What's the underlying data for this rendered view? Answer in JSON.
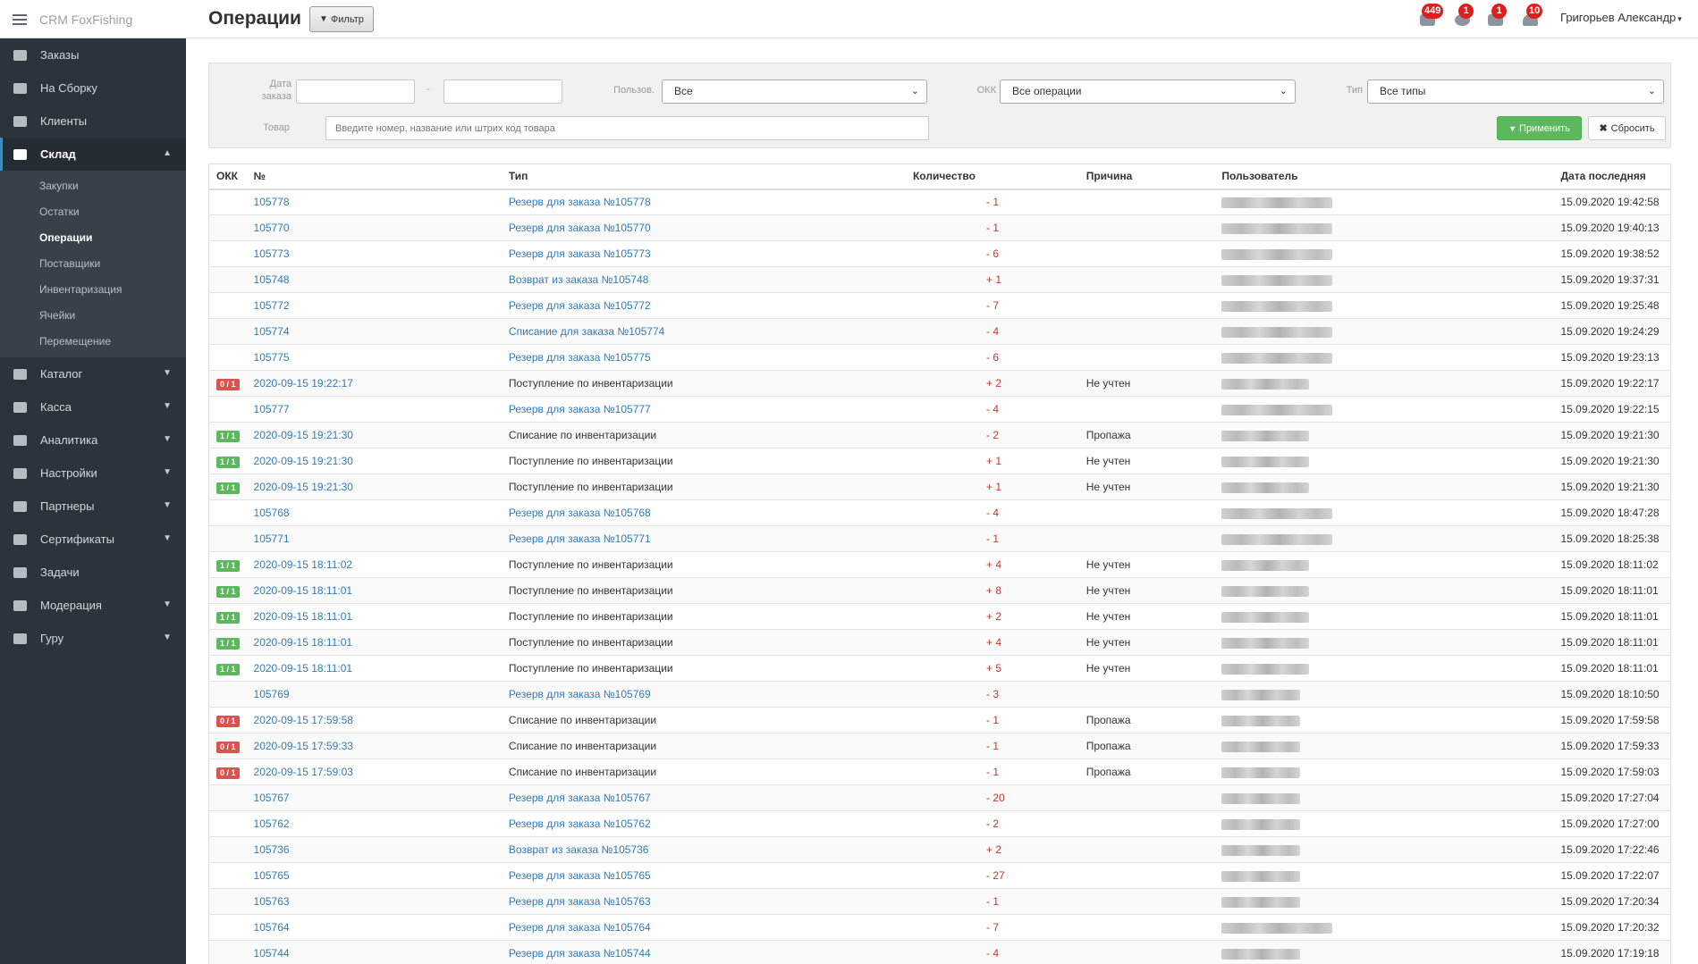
{
  "app": {
    "name": "CRM FoxFishing"
  },
  "header": {
    "title": "Операции",
    "filter_button": "Фильтр",
    "user": "Григорьев Александр",
    "notifications": [
      {
        "icon": "comments-icon",
        "count": "449"
      },
      {
        "icon": "phone-icon",
        "count": "1"
      },
      {
        "icon": "calendar-icon",
        "count": "1"
      },
      {
        "icon": "bell-icon",
        "count": "10"
      }
    ]
  },
  "sidebar": {
    "items": [
      {
        "label": "Заказы",
        "icon": "cart-icon"
      },
      {
        "label": "На Сборку",
        "icon": "box-icon"
      },
      {
        "label": "Клиенты",
        "icon": "users-icon"
      },
      {
        "label": "Склад",
        "icon": "home-icon",
        "expanded": true
      },
      {
        "label": "Каталог",
        "icon": "list-icon"
      },
      {
        "label": "Касса",
        "icon": "money-icon"
      },
      {
        "label": "Аналитика",
        "icon": "chart-icon"
      },
      {
        "label": "Настройки",
        "icon": "cogs-icon"
      },
      {
        "label": "Партнеры",
        "icon": "handshake-icon"
      },
      {
        "label": "Сертификаты",
        "icon": "certificate-icon"
      },
      {
        "label": "Задачи",
        "icon": "tag-icon"
      },
      {
        "label": "Модерация",
        "icon": "cogs-icon"
      },
      {
        "label": "Гуру",
        "icon": "walking-icon"
      }
    ],
    "warehouse_subitems": [
      "Закупки",
      "Остатки",
      "Операции",
      "Поставщики",
      "Инвентаризация",
      "Ячейки",
      "Перемещение"
    ],
    "current_subitem": "Операции"
  },
  "filters": {
    "order_date_label": "Дата заказа",
    "date_separator": "-",
    "user_label": "Пользов.",
    "user_value": "Все",
    "okk_label": "ОКК",
    "okk_value": "Все операции",
    "type_label": "Тип",
    "type_value": "Все типы",
    "product_label": "Товар",
    "product_placeholder": "Введите номер, название или штрих код товара",
    "apply": "Применить",
    "reset": "Сбросить"
  },
  "table": {
    "columns": [
      "ОКК",
      "№",
      "Тип",
      "Количество",
      "Причина",
      "Пользователь",
      "Дата последняя"
    ],
    "rows": [
      {
        "okk": "",
        "num": "105778",
        "type": "Резерв для заказа №105778",
        "link": true,
        "qty": "- 1",
        "reason": "",
        "user_blur": 124,
        "date": "15.09.2020 19:42:58"
      },
      {
        "okk": "",
        "num": "105770",
        "type": "Резерв для заказа №105770",
        "link": true,
        "qty": "- 1",
        "reason": "",
        "user_blur": 124,
        "date": "15.09.2020 19:40:13"
      },
      {
        "okk": "",
        "num": "105773",
        "type": "Резерв для заказа №105773",
        "link": true,
        "qty": "- 6",
        "reason": "",
        "user_blur": 124,
        "date": "15.09.2020 19:38:52"
      },
      {
        "okk": "",
        "num": "105748",
        "type": "Возврат из заказа №105748",
        "link": true,
        "qty": "+ 1",
        "reason": "",
        "user_blur": 124,
        "date": "15.09.2020 19:37:31"
      },
      {
        "okk": "",
        "num": "105772",
        "type": "Резерв для заказа №105772",
        "link": true,
        "qty": "- 7",
        "reason": "",
        "user_blur": 124,
        "date": "15.09.2020 19:25:48"
      },
      {
        "okk": "",
        "num": "105774",
        "type": "Списание для заказа №105774",
        "link": true,
        "qty": "- 4",
        "reason": "",
        "user_blur": 124,
        "date": "15.09.2020 19:24:29"
      },
      {
        "okk": "",
        "num": "105775",
        "type": "Резерв для заказа №105775",
        "link": true,
        "qty": "- 6",
        "reason": "",
        "user_blur": 124,
        "date": "15.09.2020 19:23:13"
      },
      {
        "okk": "0 / 1",
        "okk_color": "red",
        "num": "2020-09-15 19:22:17",
        "type": "Поступление по инвентаризации",
        "link": false,
        "qty": "+ 2",
        "reason": "Не учтен",
        "user_blur": 98,
        "date": "15.09.2020 19:22:17"
      },
      {
        "okk": "",
        "num": "105777",
        "type": "Резерв для заказа №105777",
        "link": true,
        "qty": "- 4",
        "reason": "",
        "user_blur": 124,
        "date": "15.09.2020 19:22:15"
      },
      {
        "okk": "1 / 1",
        "okk_color": "green",
        "num": "2020-09-15 19:21:30",
        "type": "Списание по инвентаризации",
        "link": false,
        "qty": "- 2",
        "reason": "Пропажа",
        "user_blur": 98,
        "date": "15.09.2020 19:21:30"
      },
      {
        "okk": "1 / 1",
        "okk_color": "green",
        "num": "2020-09-15 19:21:30",
        "type": "Поступление по инвентаризации",
        "link": false,
        "qty": "+ 1",
        "reason": "Не учтен",
        "user_blur": 98,
        "date": "15.09.2020 19:21:30"
      },
      {
        "okk": "1 / 1",
        "okk_color": "green",
        "num": "2020-09-15 19:21:30",
        "type": "Поступление по инвентаризации",
        "link": false,
        "qty": "+ 1",
        "reason": "Не учтен",
        "user_blur": 98,
        "date": "15.09.2020 19:21:30"
      },
      {
        "okk": "",
        "num": "105768",
        "type": "Резерв для заказа №105768",
        "link": true,
        "qty": "- 4",
        "reason": "",
        "user_blur": 124,
        "date": "15.09.2020 18:47:28"
      },
      {
        "okk": "",
        "num": "105771",
        "type": "Резерв для заказа №105771",
        "link": true,
        "qty": "- 1",
        "reason": "",
        "user_blur": 124,
        "date": "15.09.2020 18:25:38"
      },
      {
        "okk": "1 / 1",
        "okk_color": "green",
        "num": "2020-09-15 18:11:02",
        "type": "Поступление по инвентаризации",
        "link": false,
        "qty": "+ 4",
        "reason": "Не учтен",
        "user_blur": 98,
        "date": "15.09.2020 18:11:02"
      },
      {
        "okk": "1 / 1",
        "okk_color": "green",
        "num": "2020-09-15 18:11:01",
        "type": "Поступление по инвентаризации",
        "link": false,
        "qty": "+ 8",
        "reason": "Не учтен",
        "user_blur": 98,
        "date": "15.09.2020 18:11:01"
      },
      {
        "okk": "1 / 1",
        "okk_color": "green",
        "num": "2020-09-15 18:11:01",
        "type": "Поступление по инвентаризации",
        "link": false,
        "qty": "+ 2",
        "reason": "Не учтен",
        "user_blur": 98,
        "date": "15.09.2020 18:11:01"
      },
      {
        "okk": "1 / 1",
        "okk_color": "green",
        "num": "2020-09-15 18:11:01",
        "type": "Поступление по инвентаризации",
        "link": false,
        "qty": "+ 4",
        "reason": "Не учтен",
        "user_blur": 98,
        "date": "15.09.2020 18:11:01"
      },
      {
        "okk": "1 / 1",
        "okk_color": "green",
        "num": "2020-09-15 18:11:01",
        "type": "Поступление по инвентаризации",
        "link": false,
        "qty": "+ 5",
        "reason": "Не учтен",
        "user_blur": 98,
        "date": "15.09.2020 18:11:01"
      },
      {
        "okk": "",
        "num": "105769",
        "type": "Резерв для заказа №105769",
        "link": true,
        "qty": "- 3",
        "reason": "",
        "user_blur": 88,
        "date": "15.09.2020 18:10:50"
      },
      {
        "okk": "0 / 1",
        "okk_color": "red",
        "num": "2020-09-15 17:59:58",
        "type": "Списание по инвентаризации",
        "link": false,
        "qty": "- 1",
        "reason": "Пропажа",
        "user_blur": 88,
        "date": "15.09.2020 17:59:58"
      },
      {
        "okk": "0 / 1",
        "okk_color": "red",
        "num": "2020-09-15 17:59:33",
        "type": "Списание по инвентаризации",
        "link": false,
        "qty": "- 1",
        "reason": "Пропажа",
        "user_blur": 88,
        "date": "15.09.2020 17:59:33"
      },
      {
        "okk": "0 / 1",
        "okk_color": "red",
        "num": "2020-09-15 17:59:03",
        "type": "Списание по инвентаризации",
        "link": false,
        "qty": "- 1",
        "reason": "Пропажа",
        "user_blur": 88,
        "date": "15.09.2020 17:59:03"
      },
      {
        "okk": "",
        "num": "105767",
        "type": "Резерв для заказа №105767",
        "link": true,
        "qty": "- 20",
        "reason": "",
        "user_blur": 88,
        "date": "15.09.2020 17:27:04"
      },
      {
        "okk": "",
        "num": "105762",
        "type": "Резерв для заказа №105762",
        "link": true,
        "qty": "- 2",
        "reason": "",
        "user_blur": 88,
        "date": "15.09.2020 17:27:00"
      },
      {
        "okk": "",
        "num": "105736",
        "type": "Возврат из заказа №105736",
        "link": true,
        "qty": "+ 2",
        "reason": "",
        "user_blur": 88,
        "date": "15.09.2020 17:22:46"
      },
      {
        "okk": "",
        "num": "105765",
        "type": "Резерв для заказа №105765",
        "link": true,
        "qty": "- 27",
        "reason": "",
        "user_blur": 88,
        "date": "15.09.2020 17:22:07"
      },
      {
        "okk": "",
        "num": "105763",
        "type": "Резерв для заказа №105763",
        "link": true,
        "qty": "- 1",
        "reason": "",
        "user_blur": 88,
        "date": "15.09.2020 17:20:34"
      },
      {
        "okk": "",
        "num": "105764",
        "type": "Резерв для заказа №105764",
        "link": true,
        "qty": "- 7",
        "reason": "",
        "user_blur": 124,
        "date": "15.09.2020 17:20:32"
      },
      {
        "okk": "",
        "num": "105744",
        "type": "Резерв для заказа №105744",
        "link": true,
        "qty": "- 4",
        "reason": "",
        "user_blur": 88,
        "date": "15.09.2020 17:19:18"
      }
    ]
  },
  "colors": {
    "sidebar_bg": "#2b333c",
    "link": "#337ab7",
    "qty": "#c0392b",
    "apply_green": "#5cb85c",
    "okk_red": "#d9534f",
    "okk_green": "#5cb85c",
    "badge_red": "#e01e1e"
  }
}
